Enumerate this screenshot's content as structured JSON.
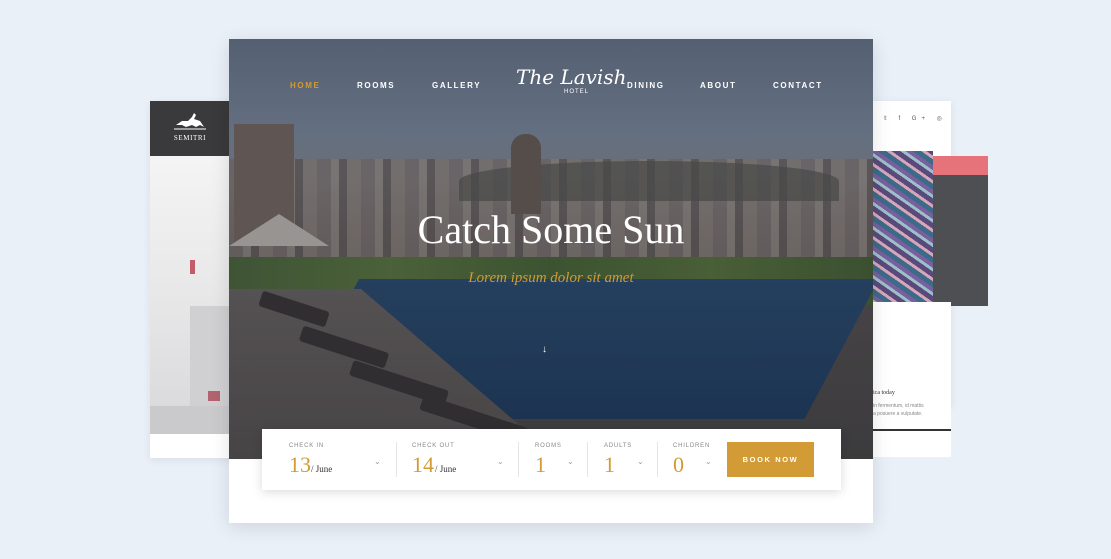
{
  "background": {
    "color": "#eaf0f8"
  },
  "left_card": {
    "brand": "SEMITRI"
  },
  "right_card": {
    "social_icons": [
      "twitter-icon",
      "facebook-icon",
      "google-plus-icon",
      "instagram-icon"
    ],
    "social_glyphs": "𝕥 f G+ ◎",
    "caption": "ica today",
    "body_lines": "in fermentum, id mattis\na posuere a vulputate."
  },
  "main_card": {
    "nav": {
      "left": [
        "HOME",
        "ROOMS",
        "GALLERY"
      ],
      "right": [
        "DINING",
        "ABOUT",
        "CONTACT"
      ],
      "active": "HOME",
      "brand_script": "The Lavish",
      "brand_sub": "HOTEL"
    },
    "hero": {
      "title": "Catch Some Sun",
      "subtitle": "Lorem ipsum dolor sit amet",
      "scroll_glyph": "↓"
    },
    "booking": {
      "check_in": {
        "label": "CHECK IN",
        "day": "13",
        "month": "/ June"
      },
      "check_out": {
        "label": "CHECK OUT",
        "day": "14",
        "month": "/ June"
      },
      "rooms": {
        "label": "ROOMS",
        "value": "1"
      },
      "adults": {
        "label": "ADULTS",
        "value": "1"
      },
      "children": {
        "label": "CHILDREN",
        "value": "0"
      },
      "chevron": "⌄",
      "button_label": "BOOK NOW"
    },
    "accent_color": "#d29b36"
  }
}
